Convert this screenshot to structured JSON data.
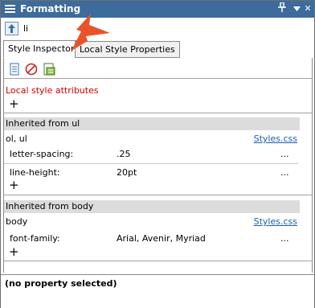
{
  "window": {
    "title": "Formatting",
    "pin_glyph": "↓",
    "close_glyph": "✕"
  },
  "breadcrumb": {
    "element": "li"
  },
  "tabs": [
    {
      "label": "Style Inspector",
      "active": true
    },
    {
      "label": "Local Style Properties",
      "active": false
    }
  ],
  "toolbar": {
    "icons": [
      "document-icon",
      "prohibited-icon",
      "stylesheet-icon"
    ]
  },
  "local": {
    "heading": "Local style attributes",
    "add_glyph": "+"
  },
  "groups": [
    {
      "header": "Inherited from ul",
      "selector": "ol, ul",
      "source": "Styles.css",
      "properties": [
        {
          "name": "letter-spacing:",
          "value": ".25",
          "more": "..."
        },
        {
          "name": "line-height:",
          "value": "20pt",
          "more": "..."
        }
      ],
      "add_glyph": "+"
    },
    {
      "header": "Inherited from body",
      "selector": "body",
      "source": "Styles.css",
      "properties": [
        {
          "name": "font-family:",
          "value": "Arial, Avenir, Myriad",
          "more": "..."
        }
      ],
      "add_glyph": "+"
    }
  ],
  "status": {
    "text": "(no property selected)"
  },
  "colors": {
    "titlebar": "#3c6b9c",
    "local_heading": "#cc0000",
    "link": "#1a5fb4",
    "callout_arrow": "#e8532a"
  }
}
